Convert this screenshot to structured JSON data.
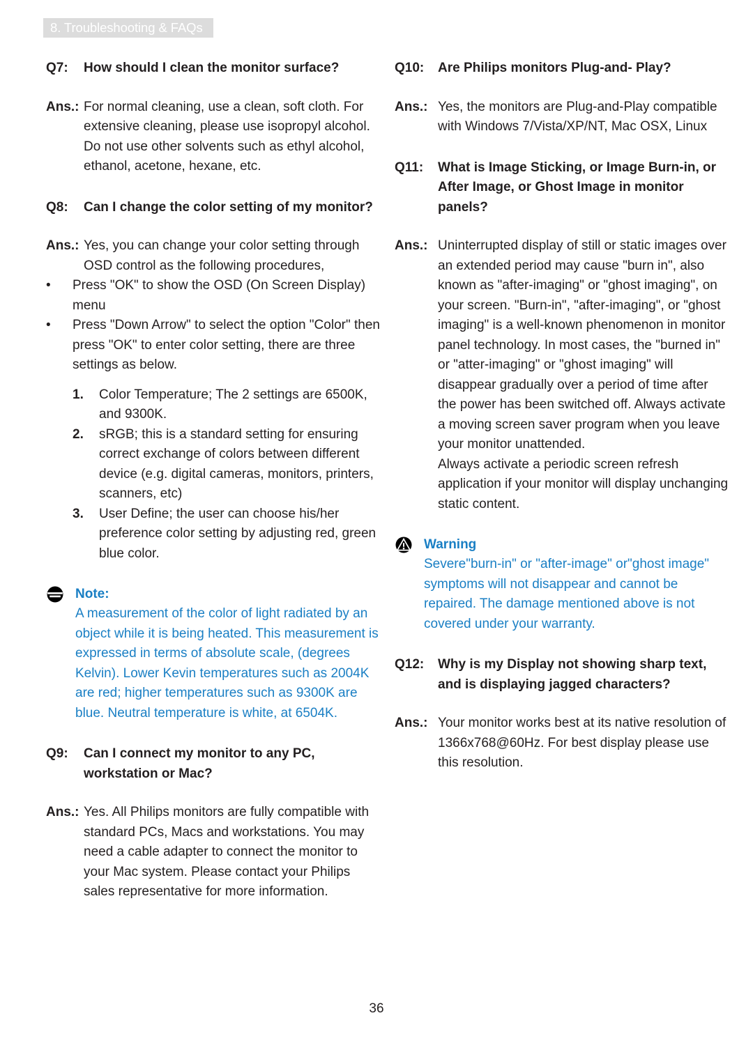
{
  "header": {
    "tab_label": "8. Troubleshooting & FAQs"
  },
  "colors": {
    "accent_blue": "#1a7fc4",
    "tab_background": "#dcdcdc",
    "tab_text": "#ffffff",
    "body_text": "#231f20"
  },
  "left_column": {
    "q7": {
      "label": "Q7:",
      "question": "How should I clean the monitor surface?",
      "ans_label": "Ans.:",
      "answer": "For normal cleaning, use a clean, soft cloth. For extensive cleaning, please use isopropyl alcohol. Do not use other solvents such as ethyl alcohol, ethanol, acetone, hexane, etc."
    },
    "q8": {
      "label": "Q8:",
      "question": "Can I change the color setting of my monitor?",
      "ans_label": "Ans.:",
      "answer": "Yes, you can change your color setting through OSD control as the following procedures,",
      "bullet_marker": "•",
      "bullets": [
        "Press \"OK\" to show the OSD (On Screen Display) menu",
        "Press \"Down Arrow\" to select the option \"Color\" then press \"OK\" to enter color setting, there are three settings as below."
      ],
      "numbered": [
        {
          "marker": "1.",
          "text": "Color Temperature; The 2 settings are 6500K, and 9300K."
        },
        {
          "marker": "2.",
          "text": "sRGB; this is a standard setting for ensuring correct exchange of colors between different device (e.g. digital cameras, monitors, printers, scanners, etc)"
        },
        {
          "marker": "3.",
          "text": "User Define; the user can choose his/her preference color setting by adjusting red, green blue color."
        }
      ]
    },
    "note": {
      "icon": "note-icon",
      "title": "Note:",
      "body": "A measurement of the color of light radiated by an object while it is being heated. This measurement is expressed in terms of absolute scale, (degrees Kelvin). Lower Kevin temperatures such as 2004K are red; higher temperatures such as 9300K are blue. Neutral temperature is white, at 6504K."
    },
    "q9": {
      "label": "Q9:",
      "question": "Can I connect my monitor to any PC, workstation or Mac?",
      "ans_label": "Ans.:",
      "answer": "Yes. All Philips monitors are fully compatible with standard PCs, Macs and workstations. You may need a cable adapter to connect the monitor to your Mac system. Please contact your Philips sales representative for more information."
    }
  },
  "right_column": {
    "q10": {
      "label": "Q10:",
      "question": "Are Philips monitors Plug-and- Play?",
      "ans_label": "Ans.:",
      "answer": "Yes, the monitors are Plug-and-Play compatible with Windows 7/Vista/XP/NT, Mac OSX, Linux"
    },
    "q11": {
      "label": "Q11:",
      "question": "What is Image Sticking, or Image Burn-in, or After Image, or Ghost Image in monitor panels?",
      "ans_label": "Ans.:",
      "answer_p1": "Uninterrupted display of still or static images over an extended period may cause \"burn in\", also known as \"after-imaging\" or \"ghost imaging\", on your screen. \"Burn-in\", \"after-imaging\", or \"ghost imaging\" is a well-known phenomenon in monitor panel technology. In most cases, the \"burned in\" or \"atter-imaging\" or \"ghost imaging\" will disappear gradually over a period of time after the power has been switched off. Always activate a moving screen saver program when you leave your monitor unattended.",
      "answer_p2": "Always activate a periodic screen refresh application if your monitor will display unchanging static content."
    },
    "warning": {
      "icon": "warning-icon",
      "title": "Warning",
      "body": "Severe\"burn-in\" or \"after-image\" or\"ghost image\" symptoms will not disappear and cannot be repaired. The damage mentioned above is not covered under your warranty."
    },
    "q12": {
      "label": "Q12:",
      "question": "Why is my Display not showing sharp text, and is displaying jagged characters?",
      "ans_label": "Ans.:",
      "answer": "Your monitor works best at its native resolution of 1366x768@60Hz. For best display please use this resolution."
    }
  },
  "footer": {
    "page_number": "36"
  }
}
